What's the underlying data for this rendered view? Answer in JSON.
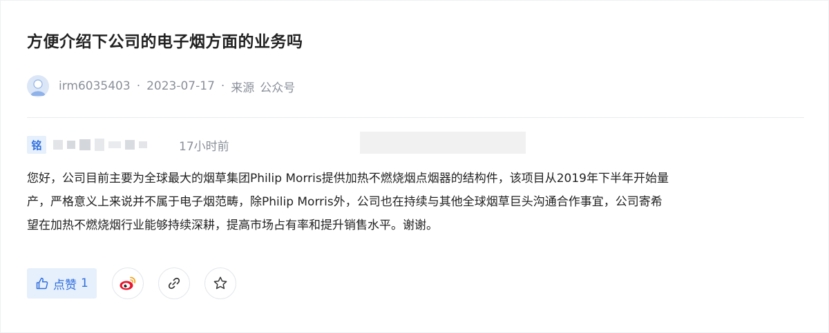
{
  "question": {
    "title": "方便介绍下公司的电子烟方面的业务吗"
  },
  "meta": {
    "username": "irm6035403",
    "separator": "·",
    "date": "2023-07-17",
    "source_label": "来源",
    "source_value": "公众号"
  },
  "reply": {
    "badge": "铭",
    "time": "17小时前",
    "lines": [
      "您好，公司目前主要为全球最大的烟草集团Philip Morris提供加热不燃烧烟点烟器的结构件，该项目从2019年下半年开始量",
      "产，严格意义上来说并不属于电子烟范畴，除Philip Morris外，公司也在持续与其他全球烟草巨头沟通合作事宜，公司寄希",
      "望在加热不燃烧烟行业能够持续深耕，提高市场占有率和提升销售水平。谢谢。"
    ]
  },
  "actions": {
    "like_label": "点赞",
    "like_count": "1",
    "like_icon": "thumbs-up-icon",
    "share_weibo_icon": "weibo-icon",
    "copy_link_icon": "link-icon",
    "favorite_icon": "star-icon"
  },
  "colors": {
    "accent": "#2f6fde",
    "accent_bg": "#e6effc",
    "muted_text": "#8a8f99",
    "weibo_red": "#e6162d",
    "weibo_orange": "#f3a21b"
  }
}
